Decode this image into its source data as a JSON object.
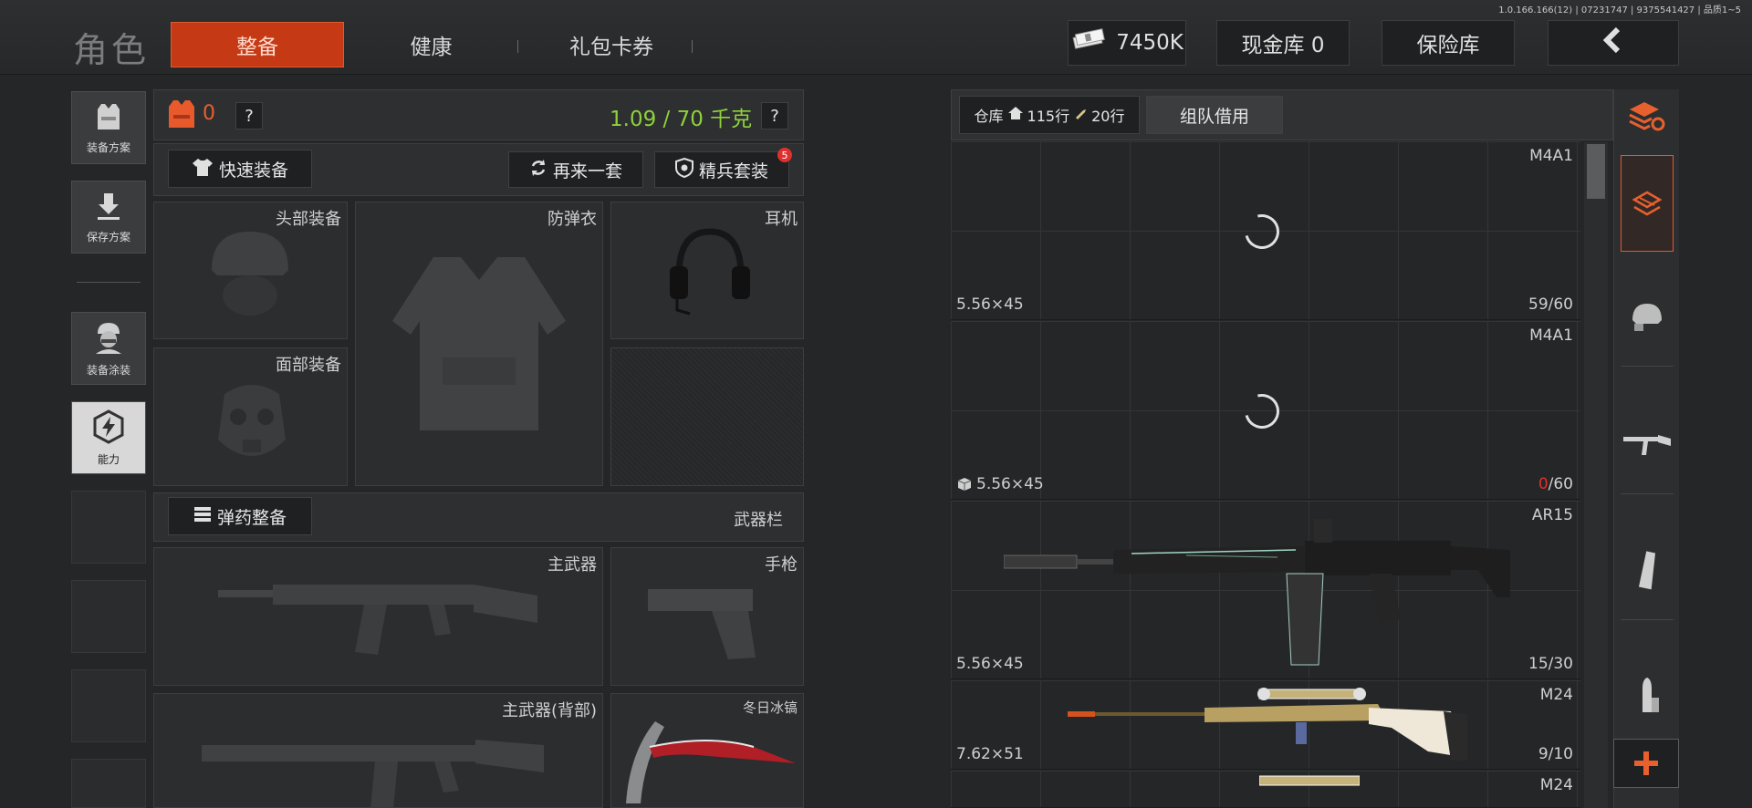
{
  "version": "1.0.166.166(12) | 07231747 | 9375541427 | 品质1~5",
  "page_title": "角色",
  "tabs": [
    {
      "label": "整备",
      "active": true
    },
    {
      "label": "健康",
      "active": false
    },
    {
      "label": "礼包卡券",
      "active": false
    }
  ],
  "top": {
    "money": "7450K",
    "cash_vault": "现金库 0",
    "safe": "保险库"
  },
  "left_nav": {
    "plan": "装备方案",
    "save": "保存方案",
    "skin": "装备涂装",
    "ability": "能力"
  },
  "gear": {
    "armor_count": "0",
    "help": "?",
    "weight": "1.09 / 70 千克",
    "quick_equip": "快速装备",
    "again": "再来一套",
    "elite": "精兵套装",
    "elite_badge": "5",
    "slots": {
      "head": "头部装备",
      "vest": "防弹衣",
      "ear": "耳机",
      "face": "面部装备"
    },
    "ammo_btn": "弹药整备",
    "weapon_bar": "武器栏",
    "primary": "主武器",
    "pistol": "手枪",
    "primary_back": "主武器(背部)",
    "melee": "冬日冰镐"
  },
  "warehouse": {
    "label": "仓库",
    "rows_house": "115行",
    "rows_ammo": "20行",
    "team_borrow": "组队借用",
    "items": [
      {
        "name": "M4A1",
        "caliber": "5.56×45",
        "ammo": "59/60",
        "ammo_cur": "59",
        "ammo_max": "/60",
        "low": false
      },
      {
        "name": "M4A1",
        "caliber": "5.56×45",
        "ammo": "0/60",
        "ammo_cur": "0",
        "ammo_max": "/60",
        "low": true
      },
      {
        "name": "AR15",
        "caliber": "5.56×45",
        "ammo": "15/30",
        "ammo_cur": "15",
        "ammo_max": "/30",
        "low": false
      },
      {
        "name": "M24",
        "caliber": "7.62×51",
        "ammo": "9/10",
        "ammo_cur": "9",
        "ammo_max": "/10",
        "low": false
      },
      {
        "name": "M24"
      }
    ]
  },
  "colors": {
    "accent": "#c53a15",
    "weight_green": "#8fd13b",
    "warn_red": "#e0302e"
  }
}
